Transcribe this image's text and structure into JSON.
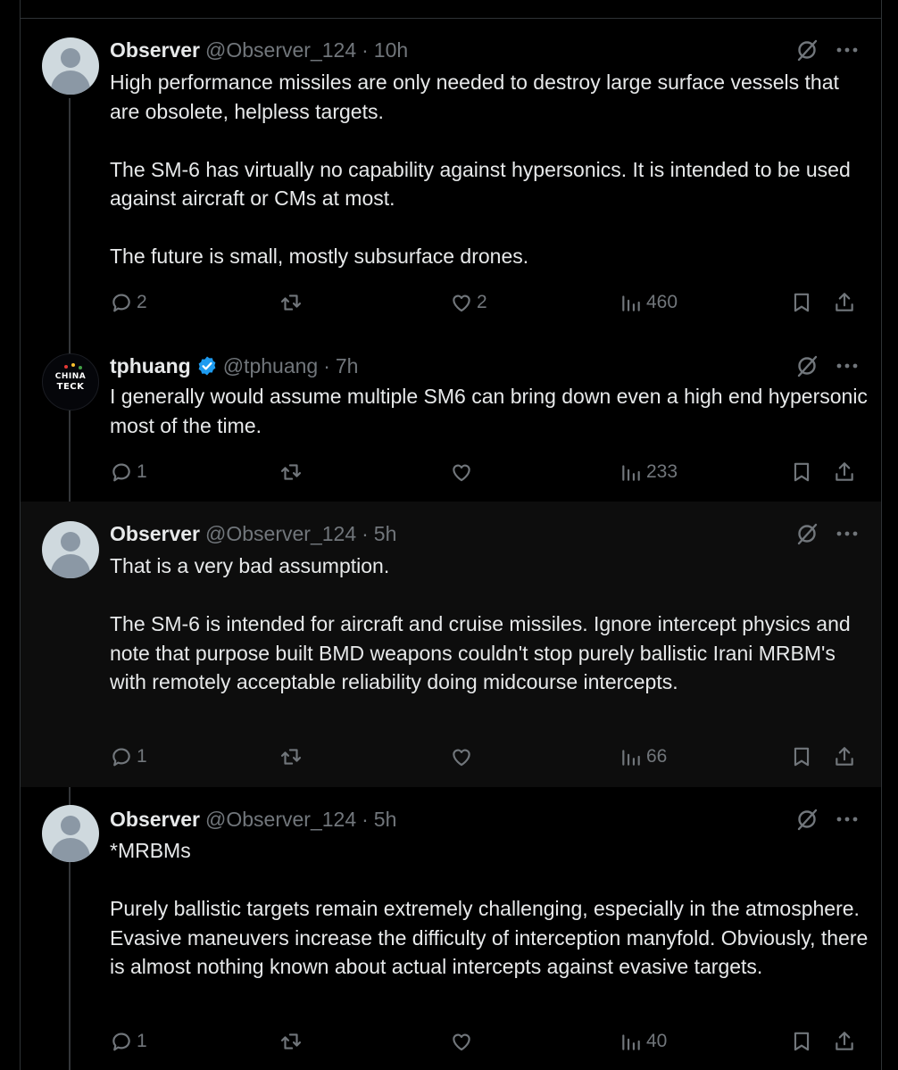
{
  "posts": [
    {
      "name": "Observer",
      "handle": "@Observer_124",
      "separator": "·",
      "time": "10h",
      "avatar": "default-avatar",
      "verified": false,
      "paragraphs": [
        "High performance missiles are only needed to destroy large surface vessels that are obsolete, helpless targets.",
        "The SM-6 has virtually no capability against hypersonics. It is intended to be used against aircraft or CMs at most.",
        "The future is small, mostly subsurface drones."
      ],
      "replies": "2",
      "reposts": "",
      "likes": "2",
      "views": "460"
    },
    {
      "name": "tphuang",
      "handle": "@tphuang",
      "separator": "·",
      "time": "7h",
      "avatar": "china-tech-logo",
      "verified": true,
      "avatar_text": [
        "CHINA",
        "TECK"
      ],
      "paragraphs": [
        "I generally would assume multiple SM6 can bring down even a high end hypersonic most of the time."
      ],
      "replies": "1",
      "reposts": "",
      "likes": "",
      "views": "233"
    },
    {
      "name": "Observer",
      "handle": "@Observer_124",
      "separator": "·",
      "time": "5h",
      "avatar": "default-avatar",
      "verified": false,
      "paragraphs": [
        "That is a very bad assumption.",
        "The SM-6 is intended for aircraft and cruise missiles. Ignore intercept physics and note that purpose built BMD weapons couldn't stop purely ballistic Irani MRBM's with remotely acceptable reliability doing midcourse intercepts."
      ],
      "replies": "1",
      "reposts": "",
      "likes": "",
      "views": "66"
    },
    {
      "name": "Observer",
      "handle": "@Observer_124",
      "separator": "·",
      "time": "5h",
      "avatar": "default-avatar",
      "verified": false,
      "paragraphs": [
        "*MRBMs",
        "Purely ballistic targets remain extremely challenging, especially in the atmosphere. Evasive maneuvers increase the difficulty of interception manyfold. Obviously, there is almost nothing known about actual intercepts against evasive targets."
      ],
      "replies": "1",
      "reposts": "",
      "likes": "",
      "views": "40"
    }
  ],
  "icons": {
    "reply": "reply-icon",
    "repost": "repost-icon",
    "like": "like-icon",
    "views": "views-icon",
    "bookmark": "bookmark-icon",
    "share": "share-icon",
    "grok": "grok-icon",
    "more": "more-icon",
    "verified": "verified-badge-icon"
  },
  "colors": {
    "background": "#000000",
    "text": "#e7e9ea",
    "muted": "#71767b",
    "verified": "#1d9bf0",
    "divider": "#2f3336",
    "highlight": "#0d0d0d"
  }
}
